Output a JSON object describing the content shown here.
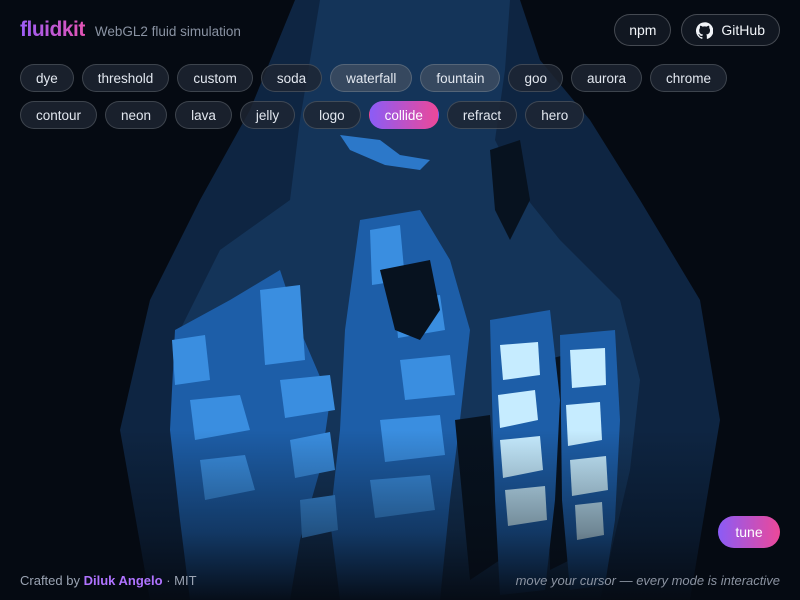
{
  "brand": {
    "name": "fluidkit",
    "subtitle": "WebGL2 fluid simulation"
  },
  "header": {
    "npm_label": "npm",
    "github_label": "GitHub",
    "github_icon": "github-icon"
  },
  "modes": [
    {
      "label": "dye"
    },
    {
      "label": "threshold"
    },
    {
      "label": "custom"
    },
    {
      "label": "soda"
    },
    {
      "label": "waterfall"
    },
    {
      "label": "fountain"
    },
    {
      "label": "goo"
    },
    {
      "label": "aurora"
    },
    {
      "label": "chrome"
    },
    {
      "label": "contour"
    },
    {
      "label": "neon"
    },
    {
      "label": "lava"
    },
    {
      "label": "jelly"
    },
    {
      "label": "logo"
    },
    {
      "label": "collide"
    },
    {
      "label": "refract"
    },
    {
      "label": "hero"
    }
  ],
  "active_mode": "collide",
  "tune_label": "tune",
  "footer": {
    "crafted_by": "Crafted by",
    "author": "Diluk Angelo",
    "license": "· MIT",
    "hint": "move your cursor — every mode is interactive"
  },
  "colors": {
    "background": "#050a12",
    "fluid_dark": "#143459",
    "fluid_mid": "#1d5ea8",
    "fluid_bright": "#3a8ee0",
    "fluid_light": "#c6ecff",
    "accent_start": "#8b5cf6",
    "accent_end": "#ec4899"
  }
}
